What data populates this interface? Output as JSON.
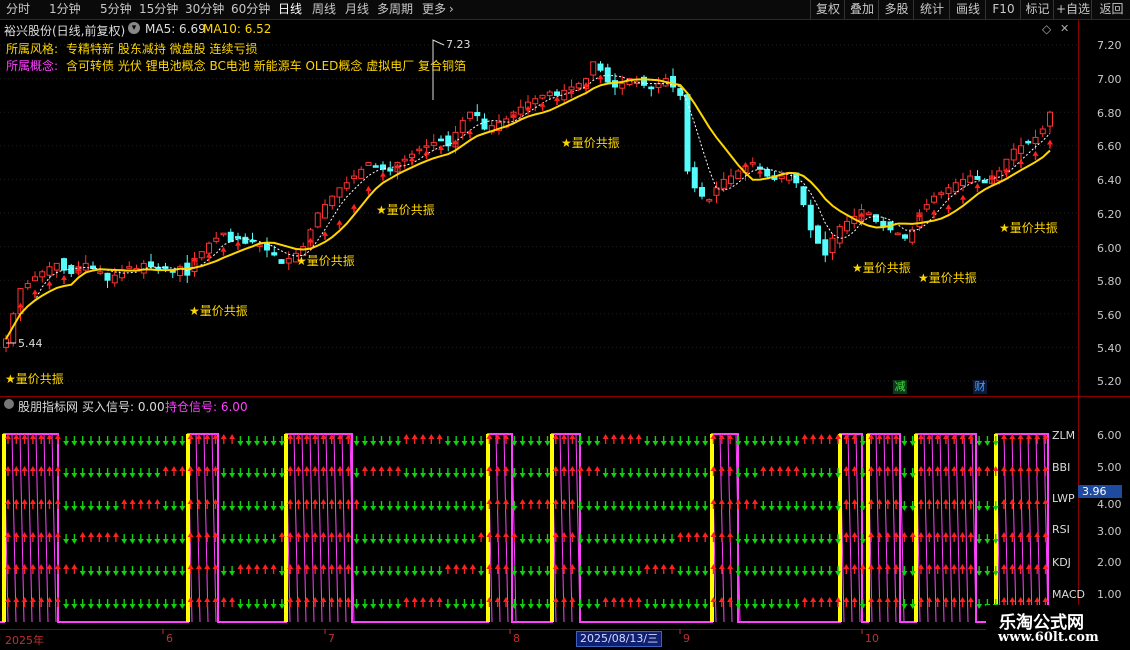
{
  "toolbar": {
    "periods": [
      "分时",
      "1分钟",
      "5分钟",
      "15分钟",
      "30分钟",
      "60分钟",
      "日线",
      "周线",
      "月线",
      "多周期",
      "更多"
    ],
    "active_period": "日线",
    "right_buttons": [
      "复权",
      "叠加",
      "多股",
      "统计",
      "画线",
      "F10",
      "标记",
      "+自选",
      "返回"
    ]
  },
  "header": {
    "stock_title": "裕兴股份(日线,前复权)",
    "ma5_label": "MA5: 6.69",
    "ma10_label": "MA10: 6.52",
    "style_label": "所属风格:",
    "style_value": "专精特新 股东减持 微盘股 连续亏损",
    "concept_label": "所属概念:",
    "concept_value": "含可转债 光伏 锂电池概念 BC电池 新能源车 OLED概念 虚拟电厂 复合铜箔"
  },
  "main_axis": {
    "ticks": [
      "7.20",
      "7.00",
      "6.80",
      "6.60",
      "6.40",
      "6.20",
      "6.00",
      "5.80",
      "5.60",
      "5.40",
      "5.20"
    ],
    "max_label": "7.23",
    "min_label": "5.44"
  },
  "annotations": {
    "text": "★量价共振",
    "markers": [
      "减",
      "财"
    ]
  },
  "sub_panel": {
    "title": "股朋指标网",
    "buy_signal": "买入信号: 0.00",
    "hold_signal": "持仓信号: 6.00",
    "row_labels": [
      "ZLM",
      "BBI",
      "LWP",
      "RSI",
      "KDJ",
      "MACD"
    ],
    "ticks": [
      "6.00",
      "5.00",
      "4.00",
      "3.00",
      "2.00",
      "1.00"
    ],
    "current_value": "3.96"
  },
  "x_axis": {
    "labels": [
      "2025年",
      "6",
      "7",
      "8",
      "9",
      "10"
    ],
    "cursor_date": "2025/08/13/三"
  },
  "watermark": {
    "title": "乐淘公式网",
    "url": "www.60lt.com"
  },
  "colors": {
    "up": "#ff3232",
    "down": "#54fcfc",
    "ma5": "#ffffff",
    "ma10": "#ffd700",
    "arrow_up": "#ff2020",
    "arrow_down": "#10d010",
    "hold_line": "#ff40ff",
    "buy_bar": "#ffff00"
  },
  "chart_data": {
    "type": "candlestick",
    "price_range": [
      5.15,
      7.3
    ],
    "x_months": [
      "2025年",
      "6",
      "7",
      "8",
      "9",
      "10"
    ],
    "close": [
      5.45,
      5.6,
      5.75,
      5.78,
      5.82,
      5.85,
      5.88,
      5.9,
      5.86,
      5.84,
      5.88,
      5.9,
      5.87,
      5.85,
      5.8,
      5.83,
      5.86,
      5.88,
      5.87,
      5.9,
      5.88,
      5.86,
      5.87,
      5.85,
      5.88,
      5.83,
      5.93,
      5.97,
      6.02,
      6.05,
      6.08,
      6.03,
      6.05,
      6.02,
      6.03,
      6.01,
      5.98,
      5.95,
      5.9,
      5.93,
      5.96,
      6.0,
      6.1,
      6.2,
      6.25,
      6.3,
      6.35,
      6.38,
      6.42,
      6.46,
      6.5,
      6.48,
      6.46,
      6.45,
      6.5,
      6.52,
      6.55,
      6.58,
      6.6,
      6.62,
      6.63,
      6.6,
      6.68,
      6.75,
      6.8,
      6.78,
      6.7,
      6.72,
      6.74,
      6.76,
      6.8,
      6.83,
      6.86,
      6.88,
      6.9,
      6.92,
      6.9,
      6.93,
      6.95,
      6.97,
      7.0,
      7.1,
      7.05,
      6.98,
      6.95,
      6.97,
      7.0,
      6.98,
      6.96,
      6.94,
      6.97,
      7.0,
      6.95,
      6.9,
      6.45,
      6.35,
      6.3,
      6.28,
      6.35,
      6.4,
      6.42,
      6.45,
      6.48,
      6.5,
      6.46,
      6.42,
      6.4,
      6.42,
      6.44,
      6.38,
      6.25,
      6.1,
      6.02,
      5.95,
      6.05,
      6.12,
      6.15,
      6.18,
      6.22,
      6.2,
      6.15,
      6.12,
      6.1,
      6.08,
      6.05,
      6.1,
      6.2,
      6.25,
      6.3,
      6.32,
      6.35,
      6.38,
      6.4,
      6.42,
      6.4,
      6.38,
      6.42,
      6.45,
      6.52,
      6.58,
      6.6,
      6.62,
      6.65,
      6.7,
      6.8
    ]
  }
}
